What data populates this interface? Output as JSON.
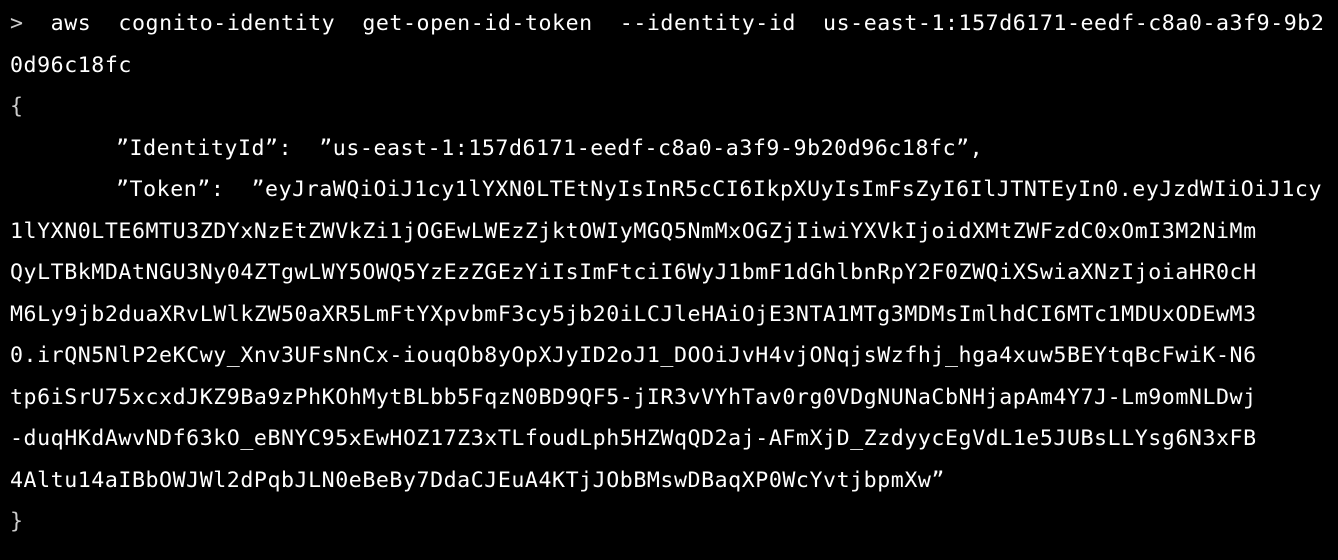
{
  "terminal": {
    "prompt_symbol": ">",
    "command": "  aws  cognito-identity  get-open-id-token  --identity-id  us-east-1:157d6171-eedf-c8a0-a3f9-9b2",
    "command_wrap": "0d96c18fc",
    "output": {
      "open_brace": "{",
      "identity_line": "”IdentityId”:  ”us-east-1:157d6171-eedf-c8a0-a3f9-9b20d96c18fc”,",
      "token_line_1": "”Token”:  ”eyJraWQiOiJ1cy1lYXN0LTEtNyIsInR5cCI6IkpXUyIsImFsZyI6IlJTNTEyIn0.eyJzdWIiOiJ1cy",
      "token_lines": [
        "1lYXN0LTE6MTU3ZDYxNzEtZWVkZi1jOGEwLWEzZjktOWIyMGQ5NmMxOGZjIiwiYXVkIjoidXMtZWFzdC0xOmI3M2NiMm",
        "QyLTBkMDAtNGU3Ny04ZTgwLWY5OWQ5YzEzZGEzYiIsImFtciI6WyJ1bmF1dGhlbnRpY2F0ZWQiXSwiaXNzIjoiaHR0cH",
        "M6Ly9jb2duaXRvLWlkZW50aXR5LmFtYXpvbmF3cy5jb20iLCJleHAiOjE3NTA1MTg3MDMsImlhdCI6MTc1MDUxODEwM3",
        "0.irQN5NlP2eKCwy_Xnv3UFsNnCx-iouqOb8yOpXJyID2oJ1_DOOiJvH4vjONqjsWzfhj_hga4xuw5BEYtqBcFwiK-N6",
        "tp6iSrU75xcxdJKZ9Ba9zPhKOhMytBLbb5FqzN0BD9QF5-jIR3vVYhTav0rg0VDgNUNaCbNHjapAm4Y7J-Lm9omNLDwj",
        "-duqHKdAwvNDf63kO_eBNYC95xEwHOZ17Z3xTLfoudLph5HZWqQD2aj-AFmXjD_ZzdyycEgVdL1e5JUBsLLYsg6N3xFB",
        "4Altu14aIBbOWJWl2dPqbJLN0eBeBy7DdaCJEuA4KTjJObBMswDBaqXP0WcYvtjbpmXw”"
      ],
      "close_brace": "}"
    }
  },
  "colors": {
    "background": "#000000",
    "text": "#ffffff",
    "prompt": "#cccccc"
  }
}
